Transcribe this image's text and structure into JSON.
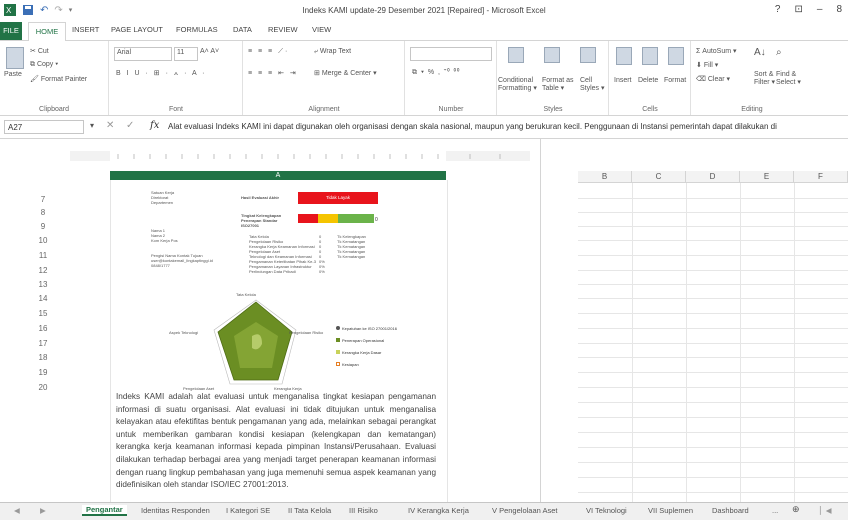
{
  "window": {
    "title": "Indeks KAMI update-29 Desember 2021 [Repaired] - Microsoft Excel",
    "controls": [
      "?",
      "⊡",
      "–",
      "8"
    ]
  },
  "ribbon_tabs": [
    "FILE",
    "HOME",
    "INSERT",
    "PAGE LAYOUT",
    "FORMULAS",
    "DATA",
    "REVIEW",
    "VIEW"
  ],
  "ribbon": {
    "clipboard": {
      "cut": "Cut",
      "copy": "Copy ▾",
      "paste": "Paste",
      "format_painter": "Format Painter",
      "label": "Clipboard"
    },
    "font": {
      "name": "Arial",
      "size": "11",
      "label": "Font",
      "row2": "B  I  U  ·  ⊞ ·  ⟑ · A ·"
    },
    "alignment": {
      "wrap": "Wrap Text",
      "merge": "Merge & Center ▾",
      "label": "Alignment"
    },
    "number": {
      "label": "Number",
      "row2": "⧉ ▾ %  ,  ⁺⁰ ⁰⁰"
    },
    "styles": {
      "conditional": "Conditional\nFormatting ▾",
      "format_table": "Format as\nTable ▾",
      "cell_styles": "Cell\nStyles ▾",
      "label": "Styles"
    },
    "cells": {
      "insert": "Insert",
      "delete": "Delete",
      "format": "Format",
      "label": "Cells"
    },
    "editing": {
      "autosum": "AutoSum ▾",
      "fill": "Fill ▾",
      "clear": "Clear ▾",
      "sort": "Sort &\nFilter ▾",
      "find": "Find &\nSelect ▾",
      "label": "Editing"
    }
  },
  "formula_bar": {
    "name_box": "A27",
    "fx": "fx",
    "content": "Alat evaluasi Indeks KAMI ini dapat digunakan oleh organisasi dengan skala nasional, maupun yang berukuran kecil. Penggunaan di Instansi pemerintah dapat dilakukan di"
  },
  "grid": {
    "col_a": "A",
    "rows": [
      "7",
      "8",
      "9",
      "10",
      "11",
      "12",
      "13",
      "14",
      "15",
      "16",
      "17",
      "18",
      "19",
      "20"
    ],
    "right_columns": [
      "B",
      "C",
      "D",
      "E",
      "F"
    ]
  },
  "page": {
    "header_lines": [
      "Satuan Kerja",
      "Direktorat",
      "Departemen"
    ],
    "score_label": "Hasil Evaluasi Akhir",
    "score_value": "Tidak Layak",
    "maturity_label": "Tingkat Kelengkapan Penerapan Standar ISO27001",
    "info_lines": [
      "Nama 1",
      "Nama 2",
      "Kom Kerja Pos"
    ],
    "contact_lines": [
      "Pengisi Nama Kontak Tujuan",
      "user@kontakemail_lingkaptinggi.id",
      "0848/1777"
    ],
    "areas": [
      {
        "name": "Tata Kelola",
        "score": "0"
      },
      {
        "name": "Pengelolaan Risiko",
        "score": "0"
      },
      {
        "name": "Kerangka Kerja Keamanan Informasi",
        "score": "0"
      },
      {
        "name": "Pengelolaan Aset",
        "score": "0"
      },
      {
        "name": "Teknologi dan Keamanan Informasi",
        "score": "0"
      },
      {
        "name": "Pengamanan Keterlibatan Pihak Ke-3",
        "score": "0%"
      },
      {
        "name": "Pengamanan Layanan Infrastruktur",
        "score": "0%"
      },
      {
        "name": "Perlindungan Data Pribadi",
        "score": "0%"
      }
    ],
    "levels": [
      "Tk Kelengkapan",
      "Tk Kematangan",
      "Tk Kematangan",
      "Tk Kematangan",
      "Tk Kematangan"
    ],
    "radar_labels": [
      "Tata Kelola",
      "Pengelolaan Risiko",
      "Kerangka Kerja",
      "Pengelolaan Aset",
      "Aspek Teknologi"
    ],
    "legend": [
      "Kepatuhan ke ISO 27001/2016",
      "Penerapan Operasional",
      "Kerangka Kerja Dasar",
      "Kesiapan"
    ],
    "legend_colors": [
      "#555555",
      "#6b8e23",
      "#c8d25a",
      "#e67e22"
    ],
    "body": "Indeks KAMI adalah alat evaluasi untuk menganalisa tingkat kesiapan pengamanan informasi di suatu organisasi. Alat evaluasi ini tidak ditujukan untuk menganalisa kelayakan atau efektifitas bentuk pengamanan yang ada, melainkan sebagai perangkat untuk memberikan gambaran kondisi kesiapan (kelengkapan dan kematangan) kerangka kerja keamanan informasi kepada pimpinan Instansi/Perusahaan. Evaluasi dilakukan terhadap berbagai area yang menjadi target penerapan keamanan informasi dengan ruang lingkup pembahasan yang juga memenuhi semua aspek keamanan yang didefinisikan oleh standar ISO/IEC 27001:2013."
  },
  "sheet_tabs": [
    "Pengantar",
    "Identitas Responden",
    "I Kategori SE",
    "II Tata Kelola",
    "III Risiko",
    "IV Kerangka Kerja",
    "V Pengelolaan Aset",
    "VI Teknologi",
    "VII Suplemen",
    "Dashboard",
    "...",
    "⊕"
  ],
  "colors": {
    "accent": "#217346",
    "red_bar": "#e8141c",
    "yellow": "#f5c400",
    "green_radar": "#6b8e23"
  }
}
